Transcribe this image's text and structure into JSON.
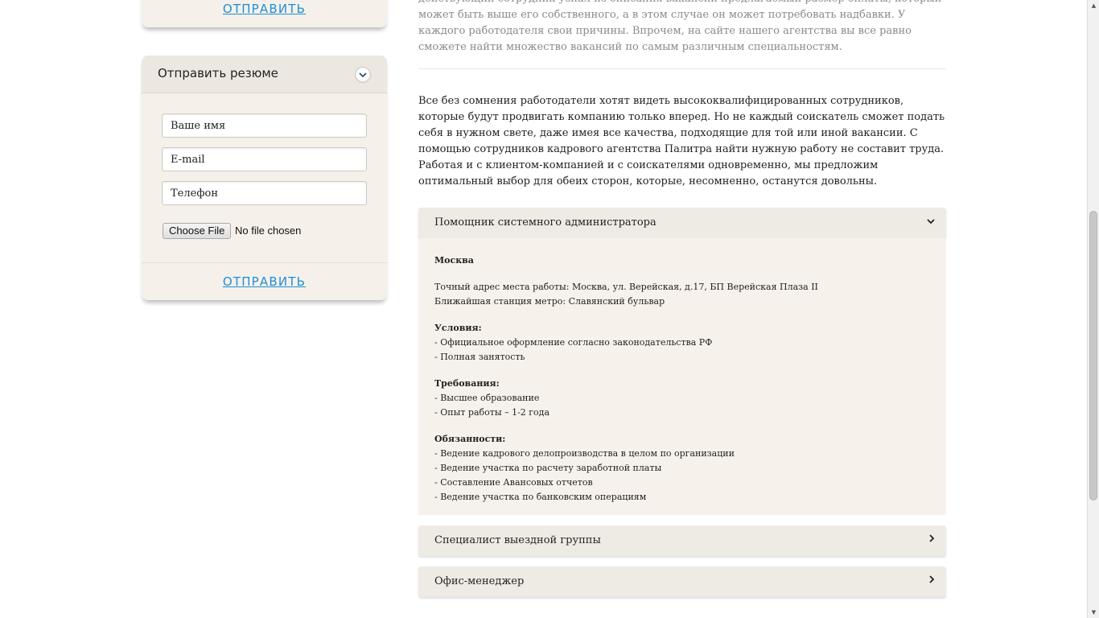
{
  "left": {
    "top_card": {
      "send_label": "ОТПРАВИТЬ"
    },
    "resume_card": {
      "title": "Отправить резюме",
      "toggle_icon": "chevron-down-icon",
      "name_placeholder": "Ваше имя",
      "email_placeholder": "E-mail",
      "phone_placeholder": "Телефон",
      "file_button": "Choose File",
      "file_status": "No file chosen",
      "send_label": "ОТПРАВИТЬ"
    }
  },
  "main": {
    "intro": "действующий сотрудник узнал из описания вакансии предлагаемый размер оплаты, который может быть выше его собственного, а в этом случае он может потребовать надбавки. У каждого работодателя свои причины. Впрочем, на сайте нашего агентства вы все равно сможете найти множество вакансий по самым различным специальностям.",
    "body": "Все без сомнения работодатели хотят видеть высококвалифицированных сотрудников, которые будут продвигать компанию только вперед. Но не каждый соискатель сможет подать себя в нужном свете, даже имея все качества, подходящие для той или иной вакансии. С помощью сотрудников кадрового агентства Палитра найти нужную работу не составит труда. Работая и с клиентом-компанией и с соискателями одновременно, мы предложим оптимальный выбор для обеих сторон, которые, несомненно, останутся довольны.",
    "vacancies": [
      {
        "title": "Помощник системного администратора",
        "expanded": true,
        "city": "Москва",
        "address": "Точный адрес места работы: Москва, ул. Верейская, д.17, БП Верейская Плаза II",
        "metro": "Ближайшая станция метро: Славянский бульвар",
        "conditions_title": "Условия:",
        "conditions": [
          "- Официальное оформление согласно законодательства РФ",
          "- Полная занятость"
        ],
        "requirements_title": "Требования:",
        "requirements": [
          "- Высшее образование",
          "- Опыт работы – 1-2 года"
        ],
        "duties_title": "Обязанности:",
        "duties": [
          "- Ведение кадрового делопроизводства в целом по организации",
          "- Ведение участка по расчету заработной платы",
          "- Составление Авансовых отчетов",
          "- Ведение участка по банковским операциям"
        ]
      },
      {
        "title": "Специалист выездной группы",
        "expanded": false
      },
      {
        "title": "Офис-менеджер",
        "expanded": false
      }
    ],
    "chevron_open": "⌄",
    "chevron_closed": "›"
  },
  "scrollbar": {
    "up": "▲",
    "down": "▼",
    "grip": "≡"
  }
}
